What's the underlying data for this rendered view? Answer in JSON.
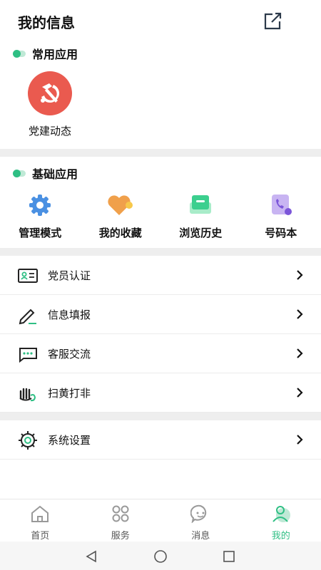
{
  "header": {
    "title": "我的信息",
    "edit_icon": "external-edit-icon"
  },
  "common_apps": {
    "title": "常用应用",
    "items": [
      {
        "label": "党建动态",
        "icon": "party-emblem-icon",
        "color": "#ea5a4f"
      }
    ]
  },
  "basic_apps": {
    "title": "基础应用",
    "items": [
      {
        "label": "管理模式",
        "icon": "gear-icon",
        "color": "#4a90e2"
      },
      {
        "label": "我的收藏",
        "icon": "heart-icon",
        "color": "#f0a04b"
      },
      {
        "label": "浏览历史",
        "icon": "history-box-icon",
        "color": "#3ccf8e"
      },
      {
        "label": "号码本",
        "icon": "phone-book-icon",
        "color": "#a07ee6"
      }
    ]
  },
  "menu_list": [
    {
      "label": "党员认证",
      "icon": "id-card-icon"
    },
    {
      "label": "信息填报",
      "icon": "pen-icon"
    },
    {
      "label": "客服交流",
      "icon": "chat-dots-icon"
    },
    {
      "label": "扫黄打非",
      "icon": "fist-icon"
    }
  ],
  "settings_list": [
    {
      "label": "系统设置",
      "icon": "settings-gear-icon"
    }
  ],
  "tabbar": {
    "items": [
      {
        "label": "首页",
        "icon": "home-icon",
        "active": false
      },
      {
        "label": "服务",
        "icon": "services-icon",
        "active": false
      },
      {
        "label": "消息",
        "icon": "message-icon",
        "active": false
      },
      {
        "label": "我的",
        "icon": "profile-icon",
        "active": true
      }
    ]
  },
  "system_nav": {
    "back": "back-triangle-icon",
    "home": "home-circle-icon",
    "recent": "recent-square-icon"
  },
  "colors": {
    "accent": "#2fbf84",
    "divider": "#eeeeee"
  }
}
